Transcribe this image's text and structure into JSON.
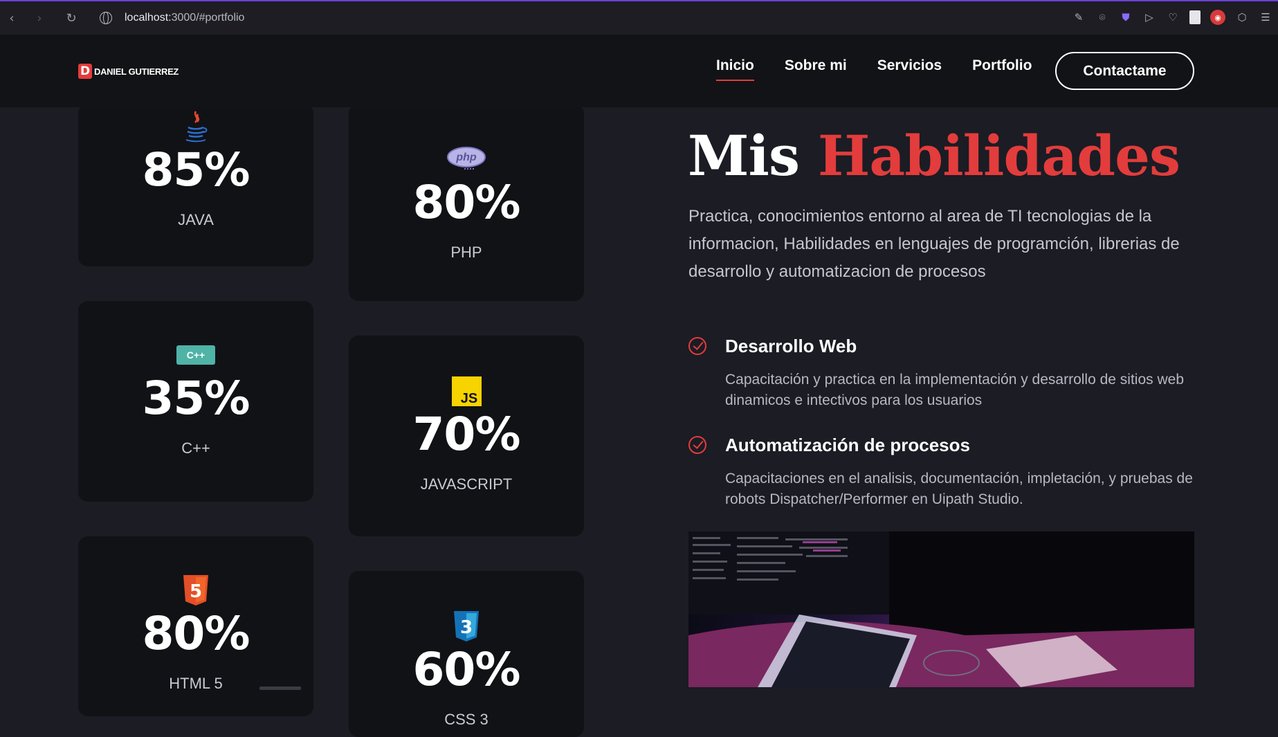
{
  "browser": {
    "url_host": "localhost:",
    "url_path": "3000/#portfolio",
    "back_glyph": "‹",
    "forward_glyph": "›",
    "reload_glyph": "↻",
    "extensions": [
      "edit-icon",
      "camera-icon",
      "shield-icon",
      "send-icon",
      "heart-icon",
      "document-icon",
      "record-icon",
      "cube-icon",
      "sidebar-icon"
    ]
  },
  "header": {
    "logo_mark": "D",
    "logo_text": "DANIEL GUTIERREZ",
    "nav": [
      "Inicio",
      "Sobre mi",
      "Servicios",
      "Portfolio"
    ],
    "contact_label": "Contactame",
    "accent_color": "#e33c3c"
  },
  "skills": [
    {
      "percent": "85%",
      "name": "JAVA",
      "icon": "java-icon"
    },
    {
      "percent": "80%",
      "name": "PHP",
      "icon": "php-icon"
    },
    {
      "percent": "35%",
      "name": "C++",
      "icon": "cpp-icon"
    },
    {
      "percent": "70%",
      "name": "JAVASCRIPT",
      "icon": "js-icon"
    },
    {
      "percent": "80%",
      "name": "HTML 5",
      "icon": "html5-icon"
    },
    {
      "percent": "60%",
      "name": "CSS 3",
      "icon": "css3-icon"
    }
  ],
  "icon_labels": {
    "cpp": "C++",
    "js": "JS",
    "php": "php",
    "html5": "5",
    "css3": "3"
  },
  "section": {
    "title_plain": "Mis",
    "title_accent": "Habilidades",
    "description": "Practica, conocimientos entorno al area de TI tecnologias de la informacion, Habilidades en lenguajes de programción, librerias de desarrollo y automatizacion de procesos",
    "features": [
      {
        "title": "Desarrollo Web",
        "description": "Capacitación y practica en la implementación y desarrollo de sitios web dinamicos e intectivos para los usuarios"
      },
      {
        "title": "Automatización de procesos",
        "description": "Capacitaciones en el analisis, documentación, impletación, y pruebas de robots Dispatcher/Performer en Uipath Studio."
      }
    ]
  }
}
